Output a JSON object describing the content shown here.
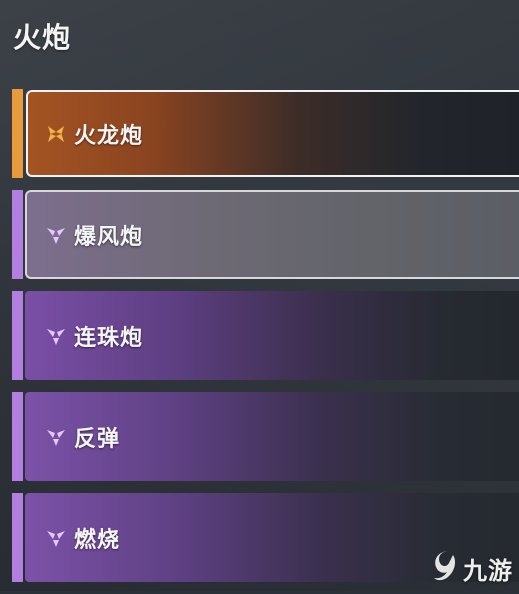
{
  "header": {
    "title": "火炮"
  },
  "items": [
    {
      "label": "火龙炮",
      "rarity": "legendary",
      "selected": true,
      "icon": "four-petal-icon",
      "accent": "#e89b3c",
      "iconColor": "#f0b24a",
      "gradient": "linear-gradient(90deg, #a45422 0%, #8a4420 25%, #3c2c28 55%, #22262c 80%, #1f2329 100%)"
    },
    {
      "label": "爆风炮",
      "rarity": "epic",
      "selected": false,
      "icon": "triangle-petal-icon",
      "accent": "#b27ee0",
      "iconColor": "#e9c6ff",
      "gradient": "linear-gradient(90deg, #7d6e8e 0%, #6e6a75 35%, #62646a 70%, #5b5e64 100%)",
      "border": "#d8d8dc"
    },
    {
      "label": "连珠炮",
      "rarity": "epic",
      "selected": false,
      "icon": "triangle-petal-icon",
      "accent": "#b27ee0",
      "iconColor": "#e9c6ff",
      "gradient": "linear-gradient(90deg, #7a4fa6 0%, #5e3f82 30%, #3a2f4c 60%, #262a31 85%, #24282e 100%)"
    },
    {
      "label": "反弹",
      "rarity": "epic",
      "selected": false,
      "icon": "triangle-petal-icon",
      "accent": "#b27ee0",
      "iconColor": "#e9c6ff",
      "gradient": "linear-gradient(90deg, #7c52a8 0%, #5f4184 30%, #3b304e 60%, #272b32 85%, #252930 100%)"
    },
    {
      "label": "燃烧",
      "rarity": "epic",
      "selected": false,
      "icon": "triangle-petal-icon",
      "accent": "#b27ee0",
      "iconColor": "#e9c6ff",
      "gradient": "linear-gradient(90deg, #7c52a8 0%, #5f4184 30%, #3b304e 60%, #272b32 85%, #252930 100%)"
    }
  ],
  "watermark": {
    "text": "九游",
    "icon": "j9-logo-icon"
  }
}
